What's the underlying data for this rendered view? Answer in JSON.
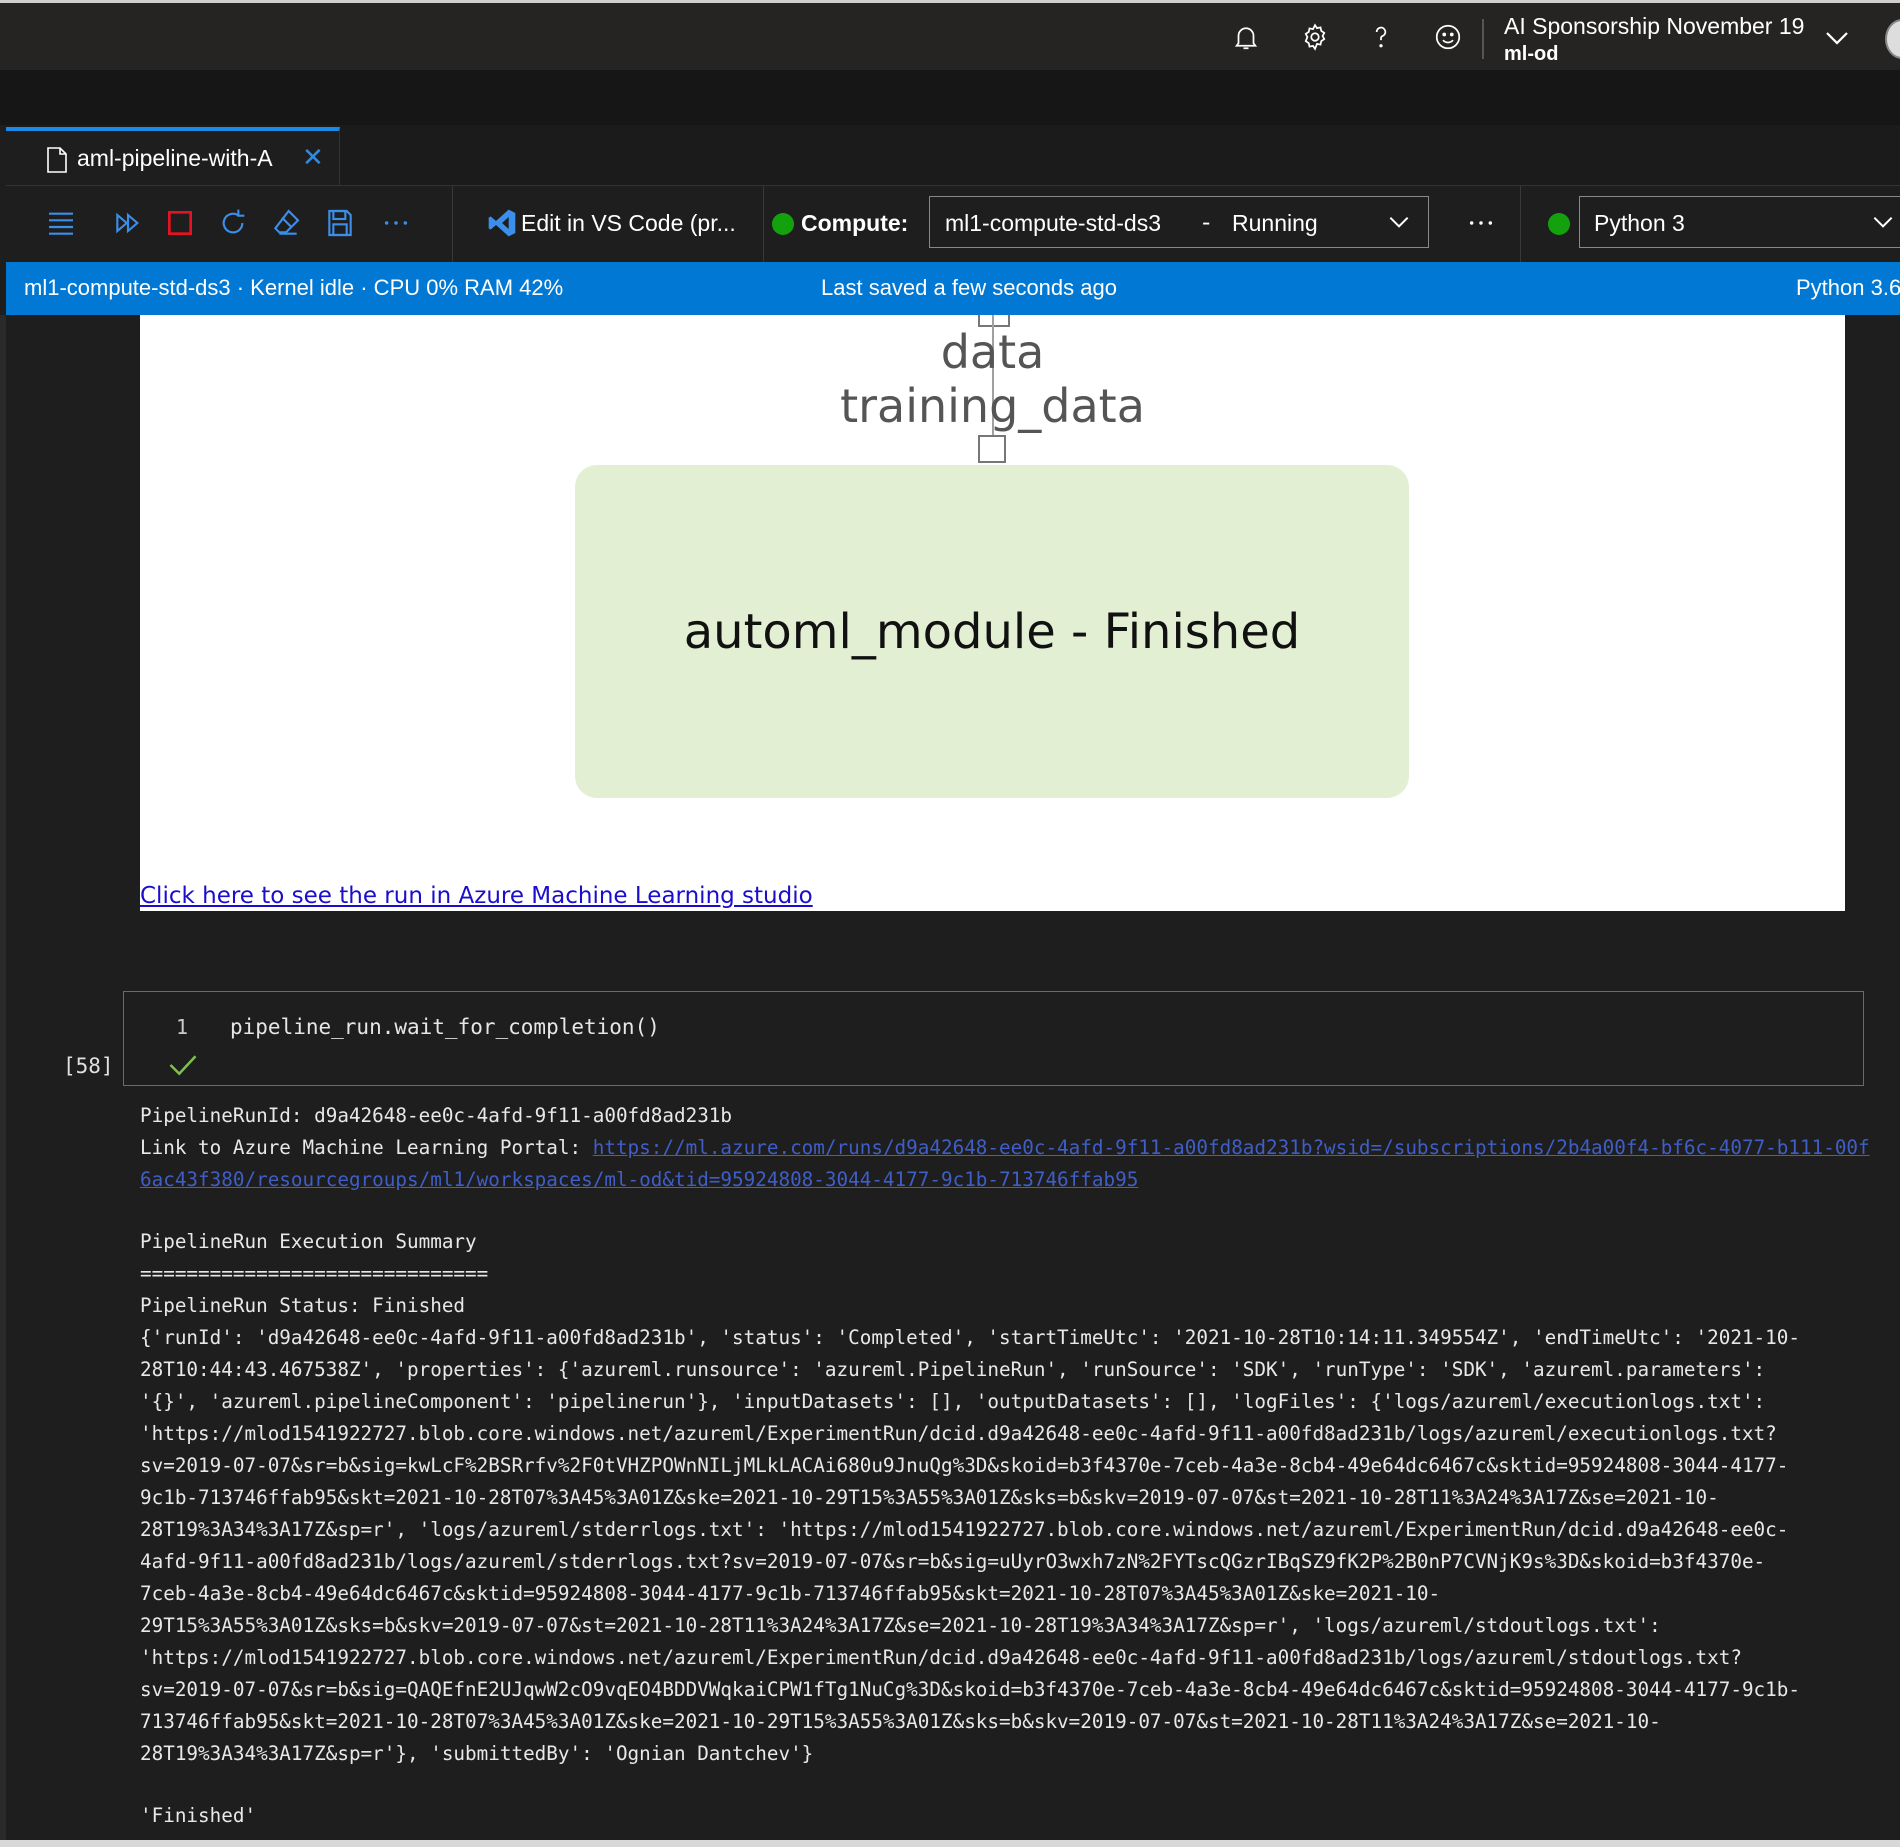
{
  "topbar": {
    "icons": [
      "bell-icon",
      "gear-icon",
      "help-icon",
      "smiley-icon"
    ],
    "account_name": "AI Sponsorship November 19",
    "workspace": "ml-od"
  },
  "tab": {
    "label": "aml-pipeline-with-A",
    "close": "✕"
  },
  "toolbar": {
    "vscode_label": "Edit in VS Code (pr...",
    "compute_label": "Compute:",
    "compute_name": "ml1-compute-std-ds3",
    "compute_dash": "-",
    "compute_status": "Running",
    "more": "···",
    "kernel": "Python 3"
  },
  "statusbar": {
    "left": "ml1-compute-std-ds3 · Kernel idle · CPU  0%   RAM 42%",
    "middle": "Last saved a few seconds ago",
    "right": "Python 3.6"
  },
  "output_graph": {
    "data_label": "data",
    "training_label": "training_data",
    "module_label": "automl_module - Finished",
    "link_text": "Click here to see the run in Azure Machine Learning studio"
  },
  "cell": {
    "line_number": "1",
    "code": "pipeline_run.wait_for_completion()",
    "exec_count": "[58]"
  },
  "output": {
    "run_id_line": "PipelineRunId: d9a42648-ee0c-4afd-9f11-a00fd8ad231b",
    "portal_prefix": "Link to Azure Machine Learning Portal: ",
    "portal_url": "https://ml.azure.com/runs/d9a42648-ee0c-4afd-9f11-a00fd8ad231b?wsid=/subscriptions/2b4a00f4-bf6c-4077-b111-00f6ac43f380/resourcegroups/ml1/workspaces/ml-od&tid=95924808-3044-4177-9c1b-713746ffab95",
    "summary_title": "PipelineRun Execution Summary",
    "summary_rule": "==============================",
    "status_line": "PipelineRun Status: Finished",
    "details_lines": [
      "{'runId': 'd9a42648-ee0c-4afd-9f11-a00fd8ad231b', 'status': 'Completed', 'startTimeUtc': '2021-10-28T10:14:11.349554Z', 'endTimeUtc': '2021-10-",
      "28T10:44:43.467538Z', 'properties': {'azureml.runsource': 'azureml.PipelineRun', 'runSource': 'SDK', 'runType': 'SDK', 'azureml.parameters':",
      "'{}', 'azureml.pipelineComponent': 'pipelinerun'}, 'inputDatasets': [], 'outputDatasets': [], 'logFiles': {'logs/azureml/executionlogs.txt':",
      "'https://mlod1541922727.blob.core.windows.net/azureml/ExperimentRun/dcid.d9a42648-ee0c-4afd-9f11-a00fd8ad231b/logs/azureml/executionlogs.txt?",
      "sv=2019-07-07&sr=b&sig=kwLcF%2BSRrfv%2F0tVHZPOWnNILjMLkLACAi680u9JnuQg%3D&skoid=b3f4370e-7ceb-4a3e-8cb4-49e64dc6467c&sktid=95924808-3044-4177-",
      "9c1b-713746ffab95&skt=2021-10-28T07%3A45%3A01Z&ske=2021-10-29T15%3A55%3A01Z&sks=b&skv=2019-07-07&st=2021-10-28T11%3A24%3A17Z&se=2021-10-",
      "28T19%3A34%3A17Z&sp=r', 'logs/azureml/stderrlogs.txt': 'https://mlod1541922727.blob.core.windows.net/azureml/ExperimentRun/dcid.d9a42648-ee0c-",
      "4afd-9f11-a00fd8ad231b/logs/azureml/stderrlogs.txt?sv=2019-07-07&sr=b&sig=uUyrO3wxh7zN%2FYTscQGzrIBqSZ9fK2P%2B0nP7CVNjK9s%3D&skoid=b3f4370e-",
      "7ceb-4a3e-8cb4-49e64dc6467c&sktid=95924808-3044-4177-9c1b-713746ffab95&skt=2021-10-28T07%3A45%3A01Z&ske=2021-10-",
      "29T15%3A55%3A01Z&sks=b&skv=2019-07-07&st=2021-10-28T11%3A24%3A17Z&se=2021-10-28T19%3A34%3A17Z&sp=r', 'logs/azureml/stdoutlogs.txt':",
      "'https://mlod1541922727.blob.core.windows.net/azureml/ExperimentRun/dcid.d9a42648-ee0c-4afd-9f11-a00fd8ad231b/logs/azureml/stdoutlogs.txt?",
      "sv=2019-07-07&sr=b&sig=QAQEfnE2UJqwW2cO9vqEO4BDDVWqkaiCPW1fTg1NuCg%3D&skoid=b3f4370e-7ceb-4a3e-8cb4-49e64dc6467c&sktid=95924808-3044-4177-9c1b-",
      "713746ffab95&skt=2021-10-28T07%3A45%3A01Z&ske=2021-10-29T15%3A55%3A01Z&sks=b&skv=2019-07-07&st=2021-10-28T11%3A24%3A17Z&se=2021-10-",
      "28T19%3A34%3A17Z&sp=r'}, 'submittedBy': 'Ognian Dantchev'}"
    ],
    "result": "'Finished'"
  }
}
